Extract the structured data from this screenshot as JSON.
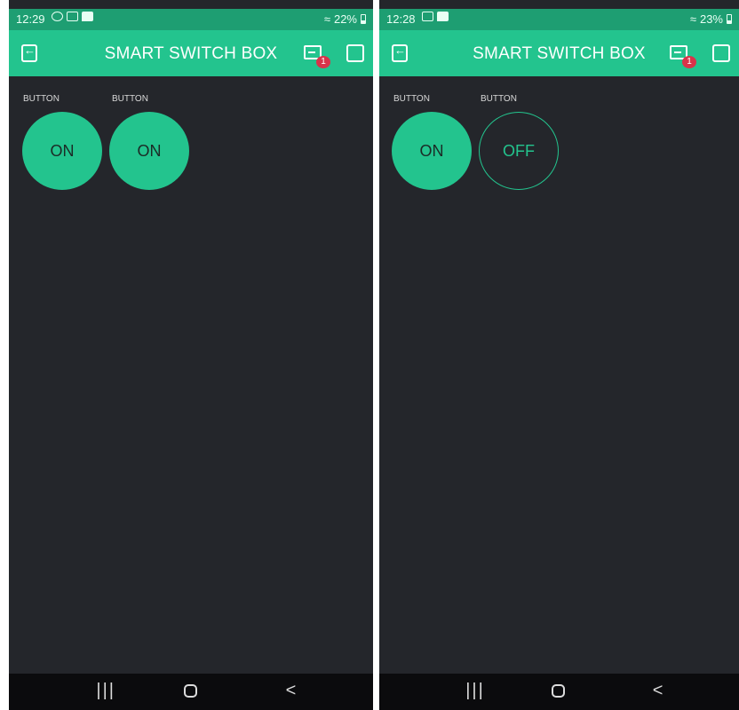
{
  "screens": [
    {
      "status": {
        "time": "12:29",
        "battery": "22%"
      },
      "app_title": "SMART SWITCH BOX",
      "notification_count": "1",
      "widgets": [
        {
          "label": "BUTTON",
          "state": "ON"
        },
        {
          "label": "BUTTON",
          "state": "ON"
        }
      ]
    },
    {
      "status": {
        "time": "12:28",
        "battery": "23%"
      },
      "app_title": "SMART SWITCH BOX",
      "notification_count": "1",
      "widgets": [
        {
          "label": "BUTTON",
          "state": "ON"
        },
        {
          "label": "BUTTON",
          "state": "OFF"
        }
      ]
    }
  ],
  "nav": {
    "recents": "|||",
    "back": "<"
  },
  "colors": {
    "accent": "#23c48e",
    "status_bar": "#1e9e72",
    "background": "#24262b",
    "badge": "#d9334a"
  }
}
